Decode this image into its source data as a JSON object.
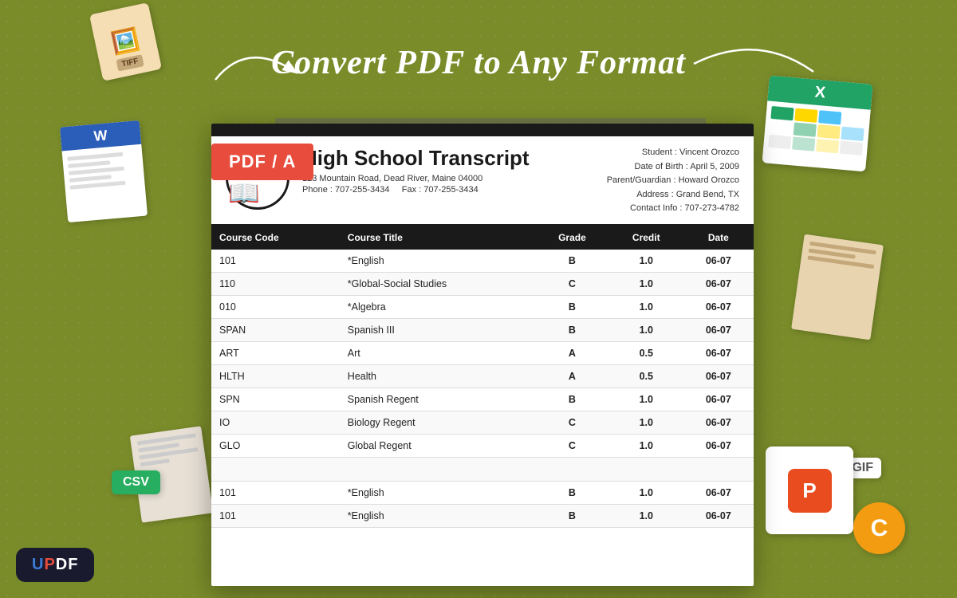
{
  "header": {
    "title": "Convert PDF to Any Format"
  },
  "pdf_badge": "PDF / A",
  "updf_logo": "UPDF",
  "transcript": {
    "title": "High School Transcript",
    "address": "123 Mountain Road, Dead River, Maine 04000",
    "phone": "Phone : 707-255-3434",
    "fax": "Fax : 707-255-3434",
    "student": "Student : Vincent Orozco",
    "dob": "Date of Birth : April 5,  2009",
    "parent": "Parent/Guardian : Howard Orozco",
    "address_info": "Address : Grand Bend, TX",
    "contact": "Contact Info : 707-273-4782",
    "columns": [
      "Course Code",
      "Course Title",
      "Grade",
      "Credit",
      "Date"
    ],
    "rows": [
      {
        "code": "101",
        "title": "*English",
        "grade": "B",
        "credit": "1.0",
        "date": "06-07"
      },
      {
        "code": "110",
        "title": "*Global-Social Studies",
        "grade": "C",
        "credit": "1.0",
        "date": "06-07"
      },
      {
        "code": "010",
        "title": "*Algebra",
        "grade": "B",
        "credit": "1.0",
        "date": "06-07"
      },
      {
        "code": "SPAN",
        "title": "Spanish III",
        "grade": "B",
        "credit": "1.0",
        "date": "06-07"
      },
      {
        "code": "ART",
        "title": "Art",
        "grade": "A",
        "credit": "0.5",
        "date": "06-07"
      },
      {
        "code": "HLTH",
        "title": "Health",
        "grade": "A",
        "credit": "0.5",
        "date": "06-07"
      },
      {
        "code": "SPN",
        "title": "Spanish Regent",
        "grade": "B",
        "credit": "1.0",
        "date": "06-07"
      },
      {
        "code": "IO",
        "title": "Biology Regent",
        "grade": "C",
        "credit": "1.0",
        "date": "06-07"
      },
      {
        "code": "GLO",
        "title": "Global Regent",
        "grade": "C",
        "credit": "1.0",
        "date": "06-07"
      }
    ],
    "extra_rows": [
      {
        "code": "101",
        "title": "*English",
        "grade": "B",
        "credit": "1.0",
        "date": "06-07"
      },
      {
        "code": "101",
        "title": "*English",
        "grade": "B",
        "credit": "1.0",
        "date": "06-07"
      }
    ]
  },
  "decorations": {
    "tiff": "TIFF",
    "csv": "CSV",
    "gif": "GIF",
    "word": "W",
    "excel": "X",
    "powerpoint": "P",
    "c_label": "C"
  }
}
